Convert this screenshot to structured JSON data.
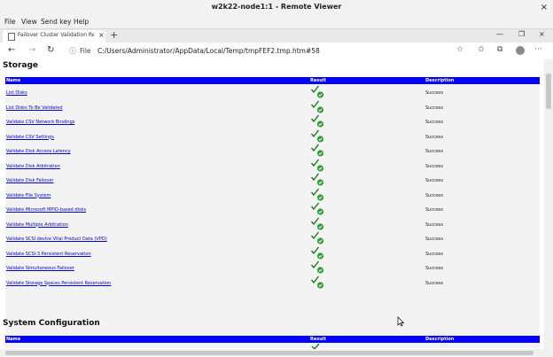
{
  "window": {
    "title": "w2k22-node1:1 - Remote Viewer",
    "close_glyph": "×"
  },
  "menu": {
    "items": [
      "File",
      "View",
      "Send key",
      "Help"
    ]
  },
  "browser": {
    "tab_title": "Failover Cluster Validation Report",
    "tab_close": "×",
    "new_tab": "+",
    "win_min": "—",
    "win_max": "❐",
    "win_close": "×",
    "back": "←",
    "forward": "→",
    "refresh": "↻",
    "info": "ⓘ",
    "scheme_label": "File",
    "url": "C:/Users/Administrator/AppData/Local/Temp/tmpFEF2.tmp.htm#58",
    "star": "☆",
    "favorites": "✩",
    "collections": "⧉",
    "more": "···"
  },
  "icons": {
    "result": "checkmark-success-icon",
    "accent": "#0000ff",
    "success": "#2e9e2e"
  },
  "storage": {
    "heading": "Storage",
    "columns": {
      "name": "Name",
      "result": "Result",
      "description": "Description"
    },
    "rows": [
      {
        "name": "List Disks",
        "description": "Success"
      },
      {
        "name": "List Disks To Be Validated",
        "description": "Success"
      },
      {
        "name": "Validate CSV Network Bindings",
        "description": "Success"
      },
      {
        "name": "Validate CSV Settings",
        "description": "Success"
      },
      {
        "name": "Validate Disk Access Latency",
        "description": "Success"
      },
      {
        "name": "Validate Disk Arbitration",
        "description": "Success"
      },
      {
        "name": "Validate Disk Failover",
        "description": "Success"
      },
      {
        "name": "Validate File System",
        "description": "Success"
      },
      {
        "name": "Validate Microsoft MPIO-based disks",
        "description": "Success"
      },
      {
        "name": "Validate Multiple Arbitration",
        "description": "Success"
      },
      {
        "name": "Validate SCSI device Vital Product Data (VPD)",
        "description": "Success"
      },
      {
        "name": "Validate SCSI-3 Persistent Reservation",
        "description": "Success"
      },
      {
        "name": "Validate Simultaneous Failover",
        "description": "Success"
      },
      {
        "name": "Validate Storage Spaces Persistent Reservation",
        "description": "Success"
      }
    ]
  },
  "system": {
    "heading": "System Configuration",
    "columns": {
      "name": "Name",
      "result": "Result",
      "description": "Description"
    }
  }
}
